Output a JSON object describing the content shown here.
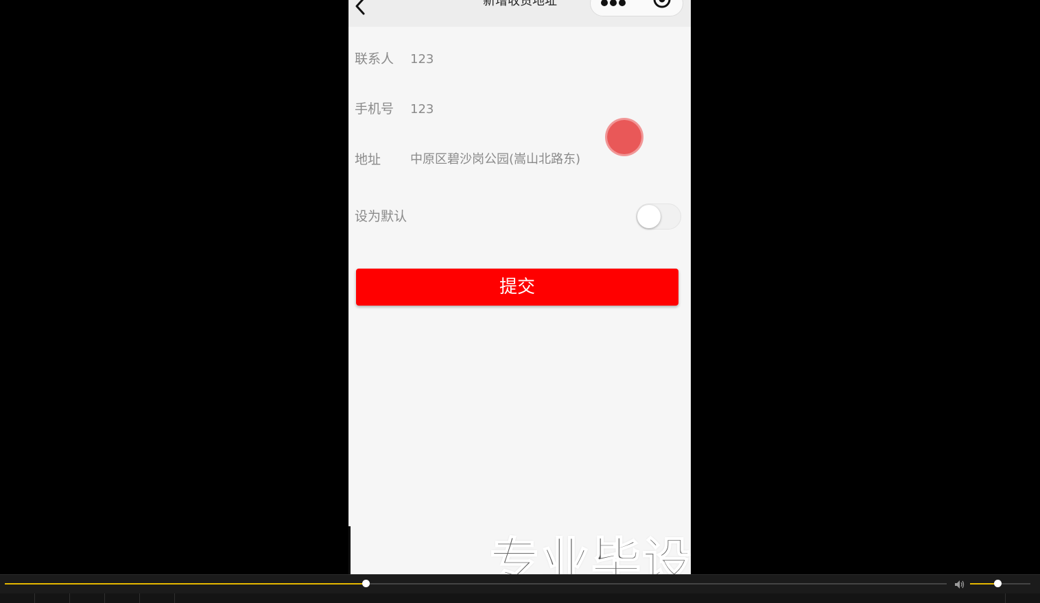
{
  "navbar": {
    "title": "新增收货地址",
    "back_icon": "chevron-left-icon",
    "more_icon": "more-dots-icon",
    "close_icon": "target-close-icon"
  },
  "form": {
    "contact_label": "联系人",
    "contact_value": "123",
    "phone_label": "手机号",
    "phone_value": "123",
    "address_label": "地址",
    "address_value": "中原区碧沙岗公园(嵩山北路东)",
    "default_label": "设为默认",
    "default_enabled": false,
    "submit_label": "提交"
  },
  "colors": {
    "submit_bg": "#ff0000",
    "progress_accent": "#e6b800",
    "touch_indicator": "#e63c3c"
  },
  "watermark": {
    "text": "专业毕设"
  },
  "player": {
    "progress": 0.383,
    "volume": 0.45
  }
}
